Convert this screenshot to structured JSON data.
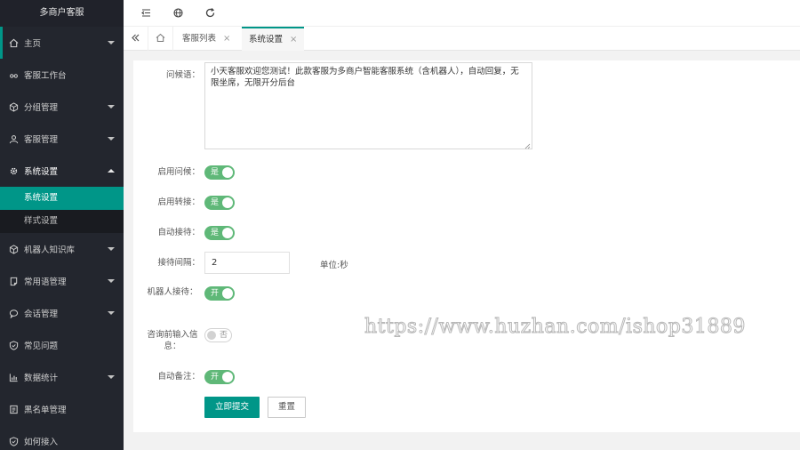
{
  "app": {
    "title": "多商户客服"
  },
  "sidebar": {
    "items": [
      {
        "label": "主页",
        "icon": "home-icon",
        "caret": "down"
      },
      {
        "label": "客服工作台",
        "icon": "headset-icon",
        "caret": ""
      },
      {
        "label": "分组管理",
        "icon": "cube-icon",
        "caret": "down"
      },
      {
        "label": "客服管理",
        "icon": "users-icon",
        "caret": "down"
      },
      {
        "label": "系统设置",
        "icon": "gear-icon",
        "caret": "up"
      },
      {
        "label": "机器人知识库",
        "icon": "cube-icon",
        "caret": "down"
      },
      {
        "label": "常用语管理",
        "icon": "note-icon",
        "caret": "down"
      },
      {
        "label": "会话管理",
        "icon": "chat-icon",
        "caret": "down"
      },
      {
        "label": "常见问题",
        "icon": "shield-icon",
        "caret": ""
      },
      {
        "label": "数据统计",
        "icon": "chart-icon",
        "caret": "down"
      },
      {
        "label": "黑名单管理",
        "icon": "list-icon",
        "caret": ""
      },
      {
        "label": "如何接入",
        "icon": "shield-icon",
        "caret": ""
      }
    ],
    "submenu": [
      {
        "label": "系统设置",
        "active": true
      },
      {
        "label": "样式设置",
        "active": false
      }
    ]
  },
  "topbar": {
    "icons": [
      "menu-fold-icon",
      "globe-icon",
      "refresh-icon"
    ]
  },
  "tabs": {
    "items": [
      {
        "label": "客服列表",
        "active": false
      },
      {
        "label": "系统设置",
        "active": true
      }
    ],
    "close_glyph": "×"
  },
  "form": {
    "greeting_label": "问候语：",
    "greeting_value": "小天客服欢迎您测试！此款客服为多商户智能客服系统（含机器人），自动回复，无限坐席，无限开分后台",
    "enable_greeting_label": "启用问候：",
    "enable_greeting_value": "是",
    "enable_transfer_label": "启用转接：",
    "enable_transfer_value": "是",
    "auto_accept_label": "自动接待：",
    "auto_accept_value": "是",
    "interval_label": "接待间隔：",
    "interval_value": "2",
    "interval_unit": "单位:秒",
    "robot_label": "机器人接待：",
    "robot_value": "开",
    "pre_input_label": "咨询前输入信息：",
    "pre_input_value": "否",
    "auto_remark_label": "自动备注：",
    "auto_remark_value": "开",
    "submit_label": "立即提交",
    "reset_label": "重置"
  },
  "watermark": "https://www.huzhan.com/ishop31889",
  "colors": {
    "accent": "#009688",
    "switch_on": "#5fb878",
    "sidebar_bg": "#23262e"
  }
}
